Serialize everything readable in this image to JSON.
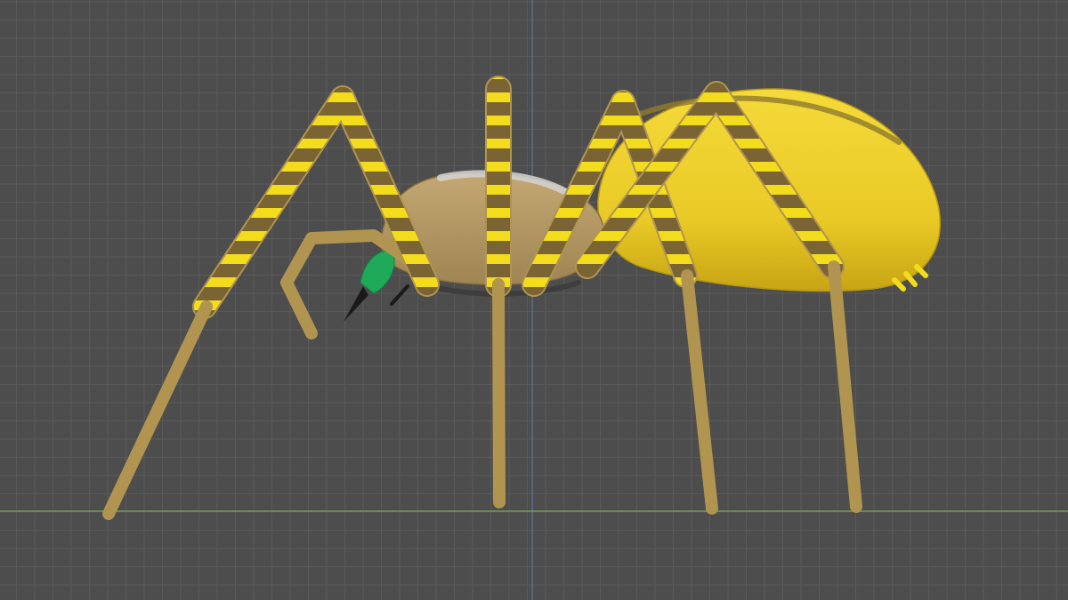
{
  "viewport": {
    "background_color": "#4d4d4d",
    "grid_minor_color": "#5a5a5a",
    "grid_major_color": "#626262",
    "x_axis_color": "#6f9a4e",
    "z_axis_color": "#5a7fb4"
  },
  "model": {
    "body_yellow": "#f0d02a",
    "body_yellow_shade": "#cda815",
    "leg_tan": "#b09450",
    "leg_tan_dark": "#8a7140",
    "leg_brown": "#7a6433",
    "band_yellow": "#f2dc1c",
    "cephalothorax_tan": "#b39863",
    "cephalothorax_highlight": "#c8c8c8",
    "fang_green": "#1faa5a",
    "fang_tip": "#1a1a1a"
  }
}
